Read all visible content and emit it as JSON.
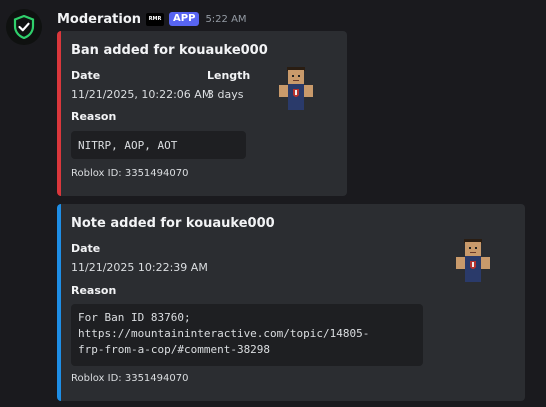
{
  "message": {
    "author": "Moderation",
    "server_tag": "RMR",
    "app_badge": "APP",
    "time": "5:22 AM"
  },
  "embeds": [
    {
      "title": "Ban added for kouauke000",
      "accent_color": "#da373c",
      "fields": [
        {
          "name": "Date",
          "value": "11/21/2025, 10:22:06 AM"
        },
        {
          "name": "Length",
          "value": "3 days"
        },
        {
          "name": "Reason",
          "value": "NITRP, AOP, AOT"
        }
      ],
      "footer": "Roblox ID: 3351494070"
    },
    {
      "title": "Note added for kouauke000",
      "accent_color": "#1e8ee6",
      "fields": [
        {
          "name": "Date",
          "value": "11/21/2025 10:22:39 AM"
        },
        {
          "name": "Reason",
          "lines": [
            "For Ban ID 83760;",
            "https://mountaininteractive.com/topic/14805-",
            "frp-from-a-cop/#comment-38298"
          ]
        }
      ],
      "footer": "Roblox ID: 3351494070"
    }
  ]
}
